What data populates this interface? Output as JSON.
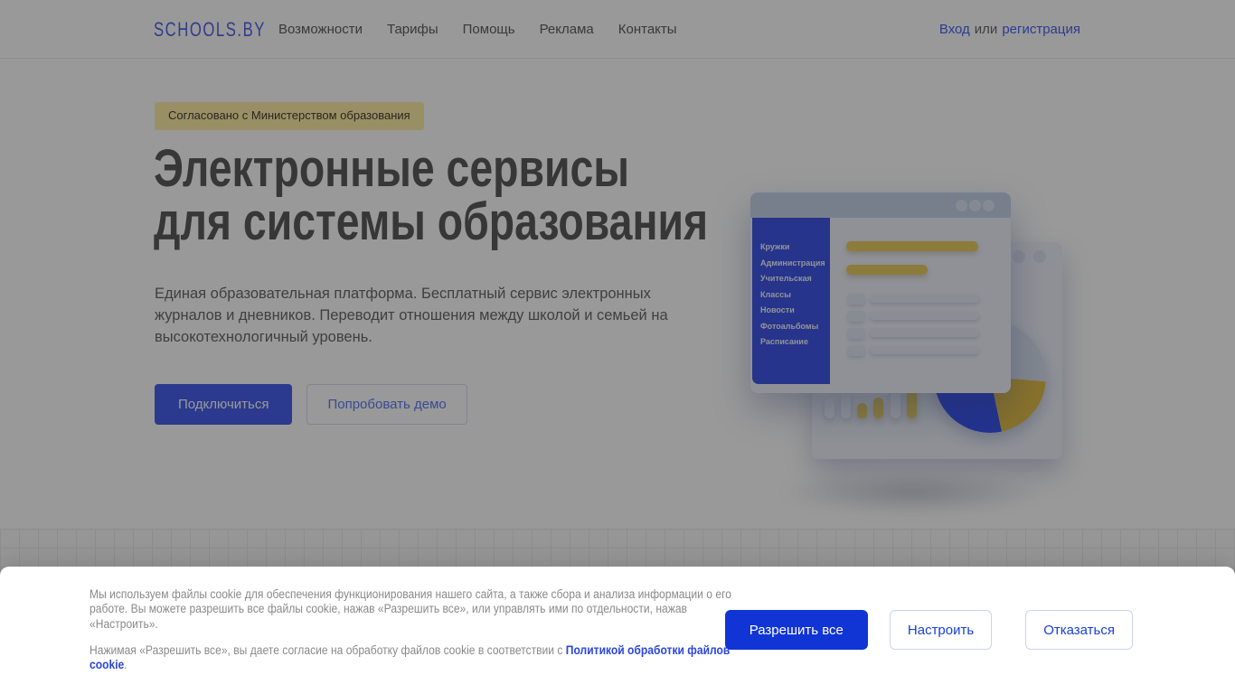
{
  "brand": {
    "logo_text": "SCHOOLS.BY"
  },
  "navbar": {
    "menu": [
      "Возможности",
      "Тарифы",
      "Помощь",
      "Реклама",
      "Контакты"
    ],
    "auth": {
      "login": "Вход",
      "separator": "или",
      "register": "регистрация"
    }
  },
  "hero": {
    "badge": "Согласовано с Министерством образования",
    "title": "Электронные сервисы\nдля системы образования",
    "description": "Единая образовательная платформа. Бесплатный сервис электронных журналов и дневников. Переводит отношения между школой и семьей на высокотехнологичный уровень.",
    "primary_button": "Подключиться",
    "secondary_button": "Попробовать демо"
  },
  "illustration": {
    "sidebar_items": [
      "Кружки",
      "Администрация",
      "Учительская",
      "Классы",
      "Новости",
      "Фотоальбомы",
      "Расписание"
    ]
  },
  "cookie_banner": {
    "paragraph1": "Мы используем файлы cookie для обеспечения функционирования нашего сайта, а также сбора и анализа информации о его работе. Вы можете разрешить все файлы cookie, нажав «Разрешить все», или управлять ими по отдельности, нажав «Настроить».",
    "paragraph2_prefix": "Нажимая «Разрешить все», вы даете согласие на обработку файлов cookie в соответствии с ",
    "policy_link": "Политикой обработки файлов cookie",
    "paragraph2_suffix": ".",
    "buttons": [
      "Разрешить все",
      "Настроить",
      "Отказаться"
    ]
  },
  "colors": {
    "brand_blue": "#1135d4",
    "hero_button_blue": "#4861ed",
    "badge_gold": "#ffefa8",
    "link_blue": "#2b46d9",
    "illustration_sidebar_blue": "#4058e8",
    "illustration_yellow": "#e9cf63",
    "pie_blue": "#3b55f0",
    "scrim": "rgba(0,0,0,0.40)"
  }
}
